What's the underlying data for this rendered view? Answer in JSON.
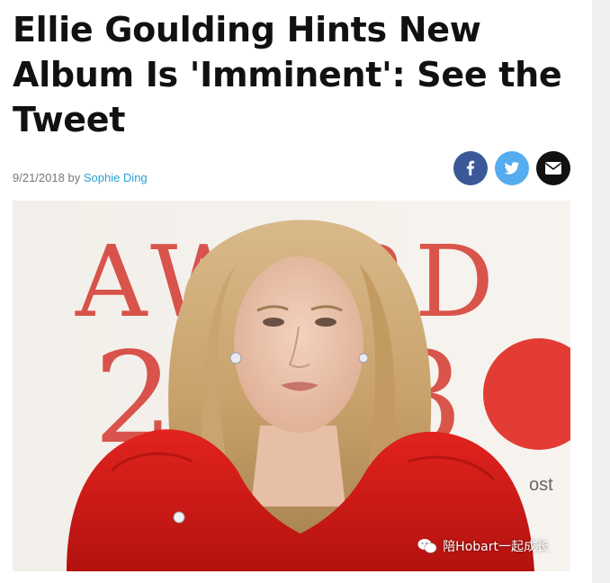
{
  "article": {
    "title": "Ellie Goulding Hints New Album Is 'Imminent': See the Tweet",
    "date": "9/21/2018",
    "by_label": "by",
    "author": "Sophie Ding"
  },
  "share": {
    "facebook_color": "#3b5998",
    "twitter_color": "#55acee",
    "email_color": "#111111"
  },
  "hero_image": {
    "backdrop_text_top": "AWARD",
    "backdrop_text_mid": "2018",
    "backdrop_text_small": "ost"
  },
  "watermark": {
    "text": "陪Hobart一起成长"
  }
}
